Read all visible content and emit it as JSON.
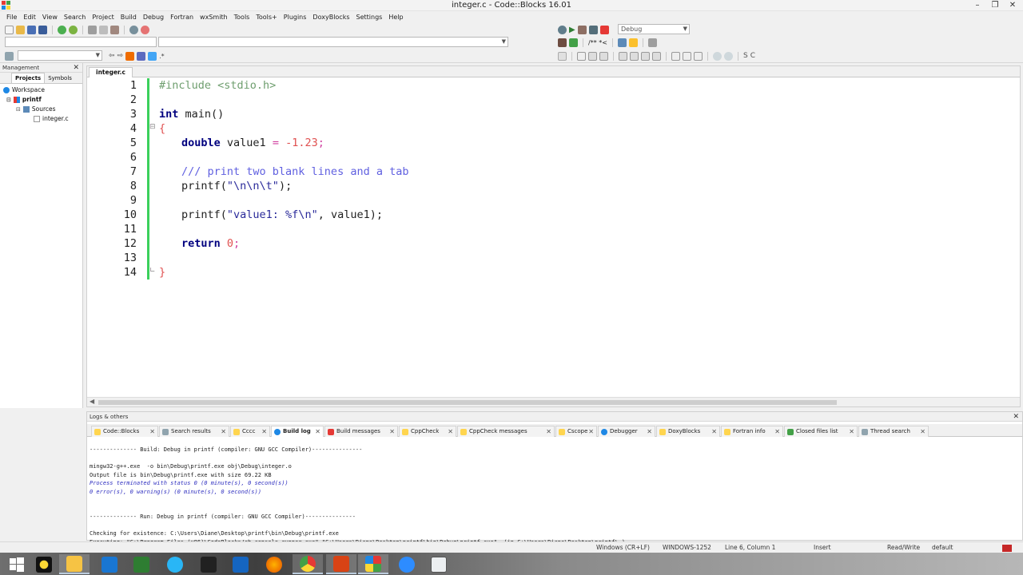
{
  "window": {
    "title": "integer.c - Code::Blocks 16.01"
  },
  "menu": [
    "File",
    "Edit",
    "View",
    "Search",
    "Project",
    "Build",
    "Debug",
    "Fortran",
    "wxSmith",
    "Tools",
    "Tools+",
    "Plugins",
    "DoxyBlocks",
    "Settings",
    "Help"
  ],
  "toolbar": {
    "build_target": "Debug",
    "debug_comment": "/** *<"
  },
  "management": {
    "header": "Management",
    "tabs": [
      "Projects",
      "Symbols"
    ],
    "tree": {
      "workspace": "Workspace",
      "project": "printf",
      "folder": "Sources",
      "file": "integer.c"
    }
  },
  "editor": {
    "tab": "integer.c",
    "line_numbers": [
      "1",
      "2",
      "3",
      "4",
      "5",
      "6",
      "7",
      "8",
      "9",
      "10",
      "11",
      "12",
      "13",
      "14"
    ],
    "code": {
      "l1": "#include <stdio.h>",
      "l3_kw": "int",
      "l3_rest": " main()",
      "l4": "{",
      "l5_kw": "double",
      "l5_var": " value1 ",
      "l5_op": "=",
      "l5_num": " -1.23",
      "l5_end": ";",
      "l7": "/// print two blank lines and a tab",
      "l8_fn": "printf(",
      "l8_str": "\"\\n\\n\\t\"",
      "l8_end": ");",
      "l10_fn": "printf(",
      "l10_str": "\"value1: %f\\n\"",
      "l10_end": ", value1);",
      "l12_kw": "return",
      "l12_num": " 0",
      "l12_end": ";",
      "l13": "}"
    }
  },
  "logs": {
    "header": "Logs & others",
    "tabs": [
      "Code::Blocks",
      "Search results",
      "Cccc",
      "Build log",
      "Build messages",
      "CppCheck",
      "CppCheck messages",
      "Cscope",
      "Debugger",
      "DoxyBlocks",
      "Fortran info",
      "Closed files list",
      "Thread search"
    ],
    "lines": [
      "-------------- Build: Debug in printf (compiler: GNU GCC Compiler)---------------",
      "",
      "mingw32-g++.exe  -o bin\\Debug\\printf.exe obj\\Debug\\integer.o",
      "Output file is bin\\Debug\\printf.exe with size 69.22 KB",
      "Process terminated with status 0 (0 minute(s), 0 second(s))",
      "0 error(s), 0 warning(s) (0 minute(s), 0 second(s))",
      "",
      "",
      "-------------- Run: Debug in printf (compiler: GNU GCC Compiler)---------------",
      "",
      "Checking for existence: C:\\Users\\Diane\\Desktop\\printf\\bin\\Debug\\printf.exe",
      "Executing: \"C:\\Program Files (x86)\\CodeBlocks/cb_console_runner.exe\" \"C:\\Users\\Diane\\Desktop\\printf\\bin\\Debug\\printf.exe\"  (in C:\\Users\\Diane\\Desktop\\printf\\.)"
    ]
  },
  "status": {
    "eol": "Windows (CR+LF)",
    "encoding": "WINDOWS-1252",
    "position": "Line 6, Column 1",
    "mode": "Insert",
    "access": "Read/Write",
    "profile": "default"
  },
  "taskbar": [
    "windows-start-icon",
    "app-icon",
    "file-explorer-icon",
    "remote-desktop-icon",
    "store-icon",
    "internet-explorer-icon",
    "media-app-icon",
    "outlook-icon",
    "firefox-icon",
    "chrome-icon",
    "powerpoint-icon",
    "codeblocks-icon",
    "video-app-icon",
    "window-app-icon"
  ]
}
